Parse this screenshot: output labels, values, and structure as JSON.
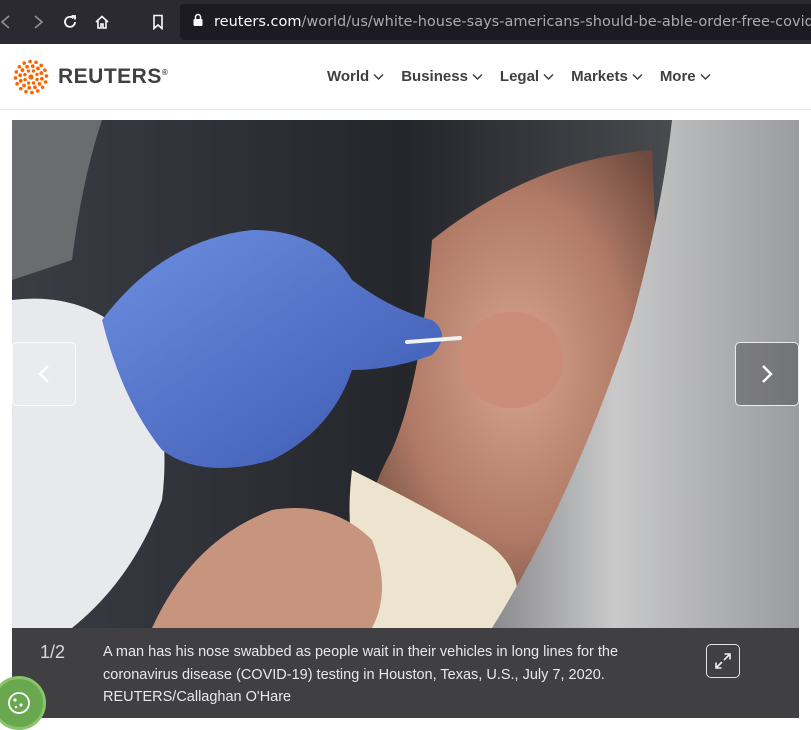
{
  "browser": {
    "url_host": "reuters.com",
    "url_path": "/world/us/white-house-says-americans-should-be-able-order-free-covid-tests",
    "icons": [
      "back-icon",
      "forward-icon",
      "reload-icon",
      "home-icon",
      "bookmark-icon",
      "lock-icon"
    ]
  },
  "header": {
    "logo_text": "REUTERS",
    "logo_mark": "®",
    "brand_color": "#fa6400",
    "nav": [
      {
        "label": "World"
      },
      {
        "label": "Business"
      },
      {
        "label": "Legal"
      },
      {
        "label": "Markets"
      },
      {
        "label": "More"
      }
    ]
  },
  "gallery": {
    "counter": "1/2",
    "caption": "A man has his nose swabbed as people wait in their vehicles in long lines for the coronavirus disease (COVID-19) testing in Houston, Texas, U.S., July 7, 2020. REUTERS/Callaghan O'Hare",
    "prev_icon": "chevron-left-icon",
    "next_icon": "chevron-right-icon",
    "expand_icon": "expand-icon"
  },
  "cookie": {
    "icon": "cookie-icon",
    "color": "#6aa84f"
  }
}
